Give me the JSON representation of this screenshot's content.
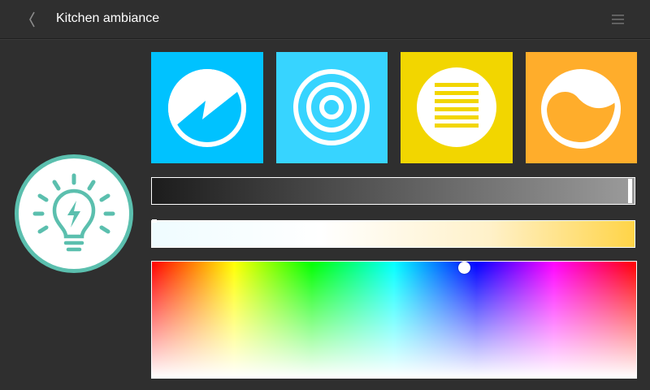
{
  "header": {
    "title": "Kitchen ambiance",
    "back_icon": "chevron-left-icon",
    "menu_icon": "hamburger-menu-icon"
  },
  "bulb": {
    "icon": "lightbulb-bolt-icon",
    "color": "#5bbfae"
  },
  "presets": [
    {
      "icon": "pie-wedge-icon",
      "color": "#00c2ff"
    },
    {
      "icon": "concentric-circles-icon",
      "color": "#37d4ff"
    },
    {
      "icon": "striped-circle-icon",
      "color": "#f2d600"
    },
    {
      "icon": "yin-yang-icon",
      "color": "#ffad2b"
    }
  ],
  "brightness": {
    "level": 1.0
  },
  "temperature": {
    "level": 0.0
  },
  "color_picker": {
    "selected_color": "#0033ff"
  }
}
